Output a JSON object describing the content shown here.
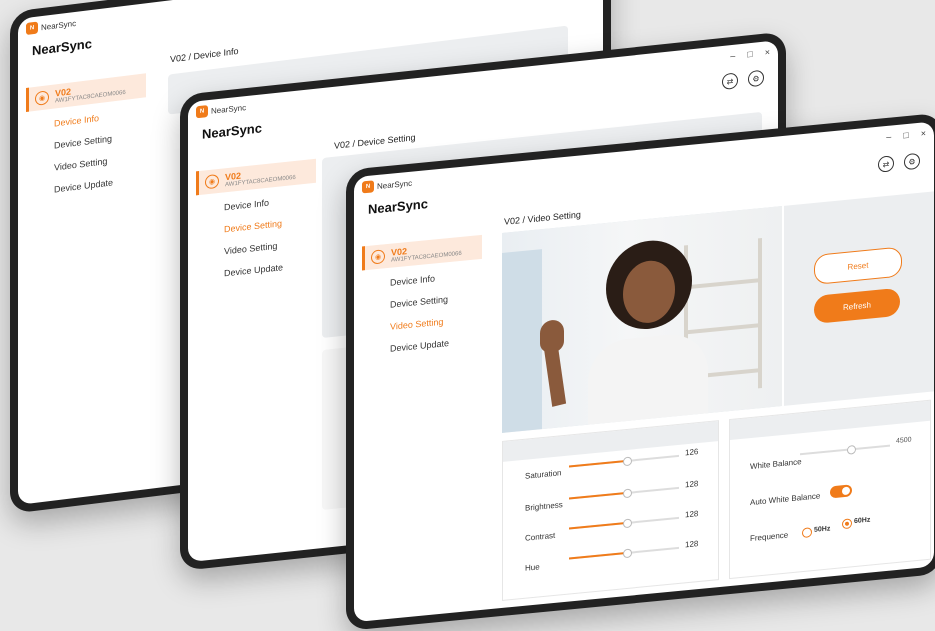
{
  "app": {
    "name": "NearSync",
    "logo_text": "N"
  },
  "window_controls": {
    "minimize": "–",
    "maximize": "□",
    "close": "×"
  },
  "device": {
    "name": "V02",
    "id": "AW1FYTAC8CAEOM0066"
  },
  "nav": {
    "items": [
      "Device Info",
      "Device Setting",
      "Video Setting",
      "Device Update"
    ]
  },
  "screens": [
    {
      "breadcrumb": "V02 / Device Info",
      "active_index": 0
    },
    {
      "breadcrumb": "V02 / Device Setting",
      "active_index": 1
    },
    {
      "breadcrumb": "V02 / Video Setting",
      "active_index": 2
    }
  ],
  "video_setting": {
    "buttons": {
      "reset": "Reset",
      "refresh": "Refresh"
    },
    "sliders": [
      {
        "label": "Saturation",
        "value": "126",
        "level": 0.52
      },
      {
        "label": "Brightness",
        "value": "128",
        "level": 0.52
      },
      {
        "label": "Contrast",
        "value": "128",
        "level": 0.52
      },
      {
        "label": "Hue",
        "value": "128",
        "level": 0.52
      }
    ],
    "white_balance": {
      "label": "White Balance",
      "value": "4500",
      "level": 0.55
    },
    "auto_white_balance": {
      "label": "Auto White Balance",
      "on": true
    },
    "frequence": {
      "label": "Frequence",
      "options": [
        "50Hz",
        "60Hz"
      ],
      "selected": "60Hz"
    }
  },
  "colors": {
    "accent": "#f07b1a",
    "panel": "#eceef0"
  }
}
